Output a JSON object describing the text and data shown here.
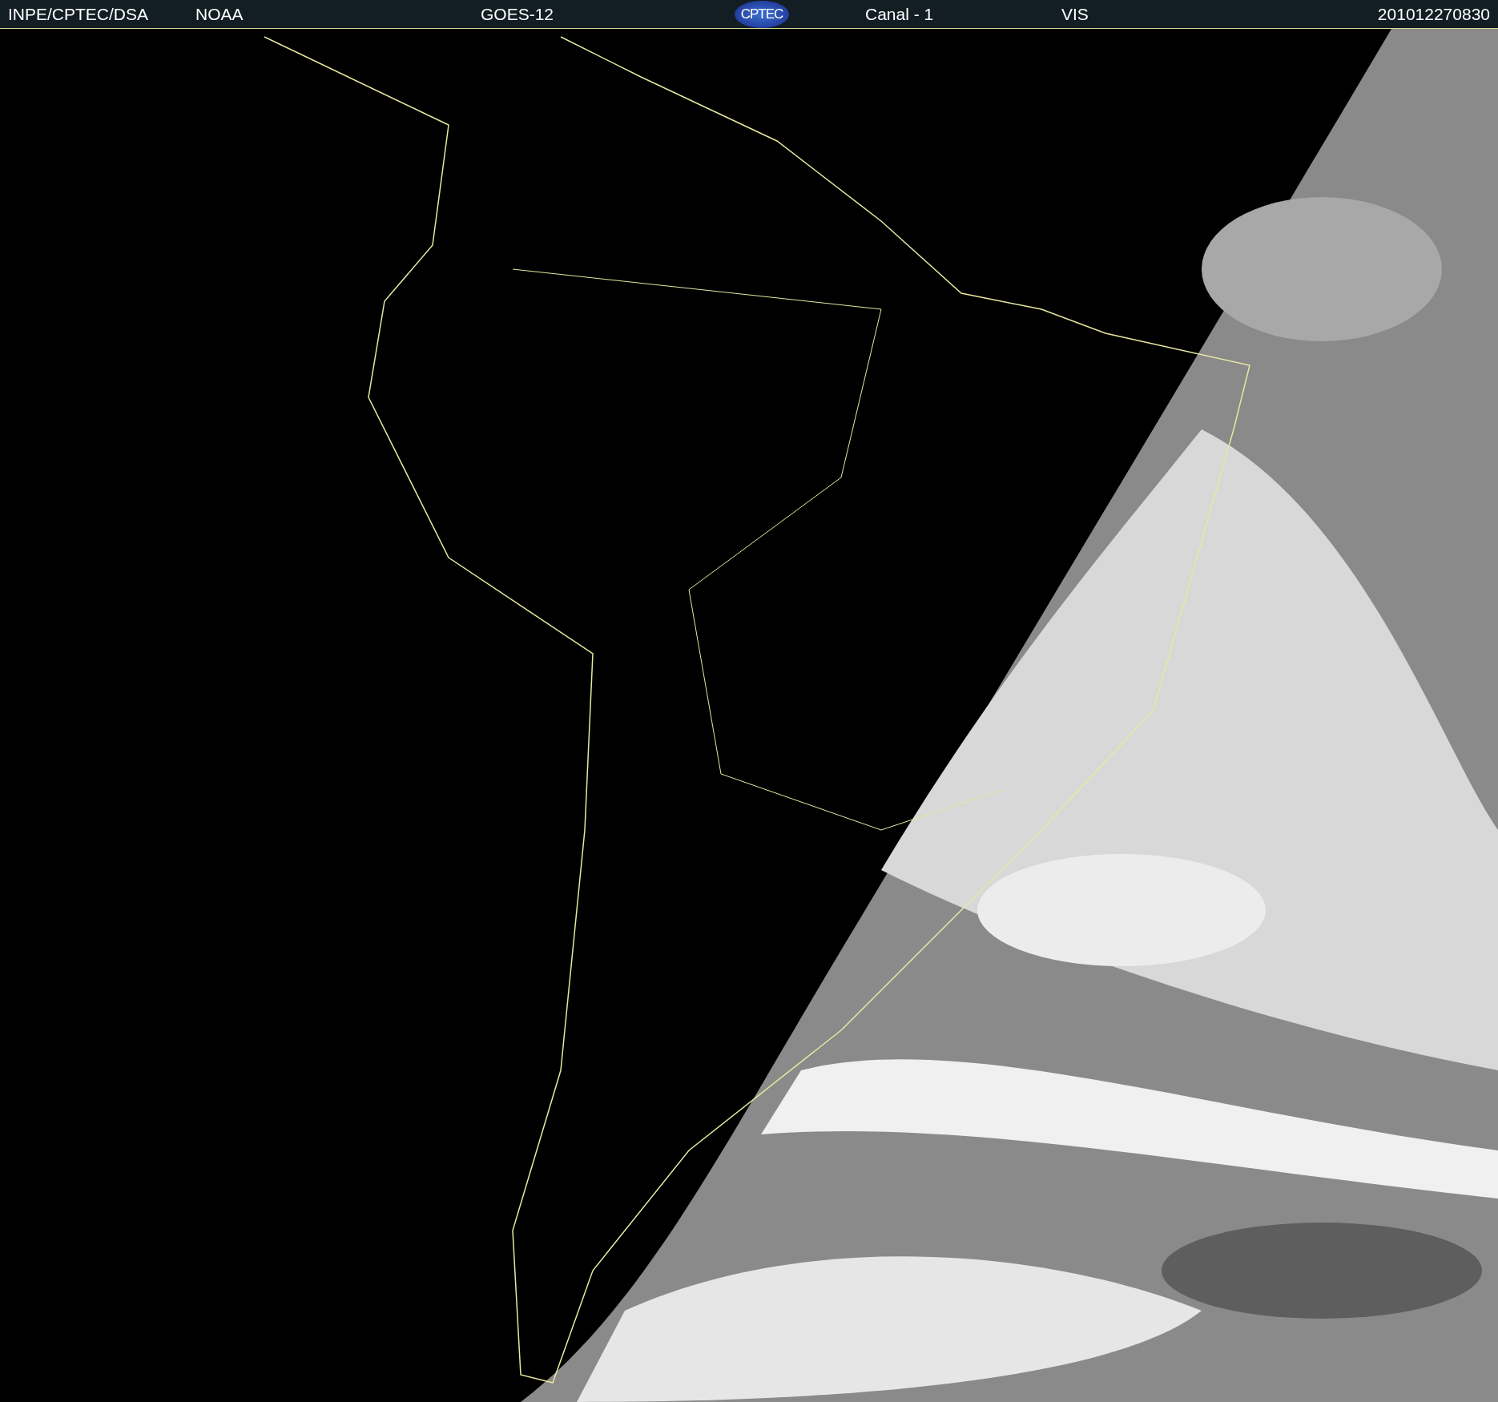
{
  "header": {
    "source": "INPE/CPTEC/DSA",
    "agency": "NOAA",
    "satellite": "GOES-12",
    "logo_text": "CPTEC",
    "channel": "Canal - 1",
    "band": "VIS",
    "timestamp": "201012270830"
  }
}
